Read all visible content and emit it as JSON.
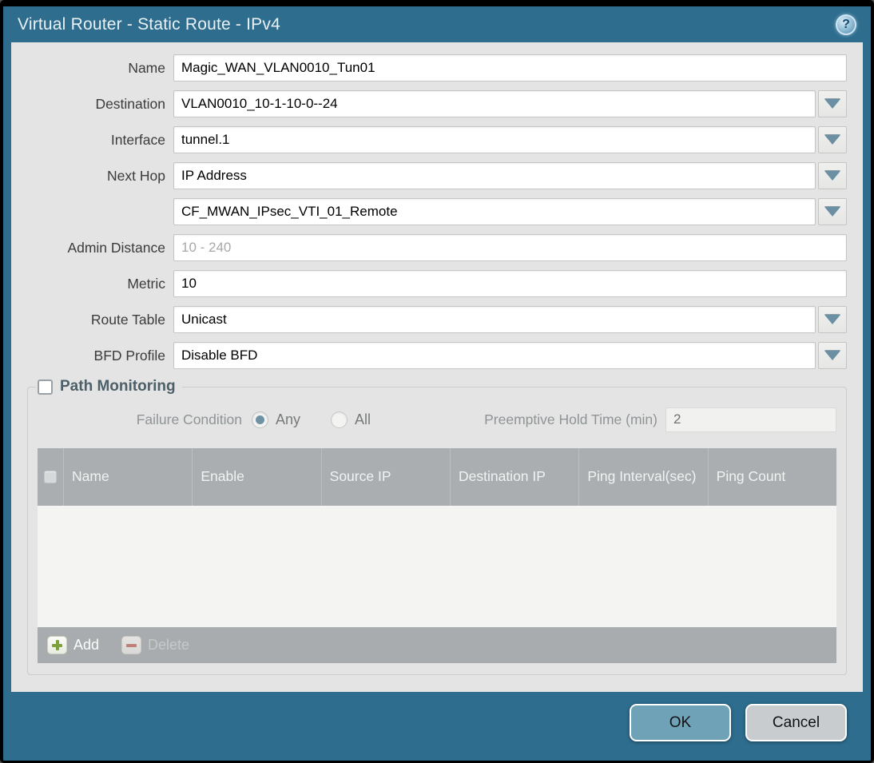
{
  "window": {
    "title": "Virtual Router - Static Route - IPv4"
  },
  "icons": {
    "help": "help-icon",
    "dropdown": "chevron-down-icon",
    "add": "plus-icon",
    "delete": "minus-icon"
  },
  "colors": {
    "titlebar": "#2E6D8E",
    "ok_button": "#6FA2B7",
    "cancel_button": "#C9CCCE",
    "table_header": "#ABAEB0",
    "radio_selected": "#6F92A4",
    "add_plus": "#7DA23B",
    "delete_minus": "#C4766E"
  },
  "form": {
    "rows": [
      {
        "label": "Name",
        "value": "Magic_WAN_VLAN0010_Tun01",
        "type": "text"
      },
      {
        "label": "Destination",
        "value": "VLAN0010_10-1-10-0--24",
        "type": "combo"
      },
      {
        "label": "Interface",
        "value": "tunnel.1",
        "type": "combo"
      },
      {
        "label": "Next Hop",
        "value": "IP Address",
        "type": "combo"
      },
      {
        "label": "",
        "value": "CF_MWAN_IPsec_VTI_01_Remote",
        "type": "combo"
      },
      {
        "label": "Admin Distance",
        "value": "",
        "placeholder": "10 - 240",
        "type": "text"
      },
      {
        "label": "Metric",
        "value": "10",
        "type": "text"
      },
      {
        "label": "Route Table",
        "value": "Unicast",
        "type": "combo"
      },
      {
        "label": "BFD Profile",
        "value": "Disable BFD",
        "type": "combo"
      }
    ]
  },
  "path_monitoring": {
    "title": "Path Monitoring",
    "checked": false,
    "failure_condition": {
      "label": "Failure Condition",
      "options": [
        {
          "label": "Any",
          "selected": true
        },
        {
          "label": "All",
          "selected": false
        }
      ]
    },
    "preemptive_hold": {
      "label": "Preemptive Hold Time (min)",
      "value": "2"
    },
    "table": {
      "columns": [
        "Name",
        "Enable",
        "Source IP",
        "Destination IP",
        "Ping Interval(sec)",
        "Ping Count"
      ],
      "rows": [],
      "add_label": "Add",
      "delete_label": "Delete"
    }
  },
  "footer": {
    "ok_label": "OK",
    "cancel_label": "Cancel"
  }
}
